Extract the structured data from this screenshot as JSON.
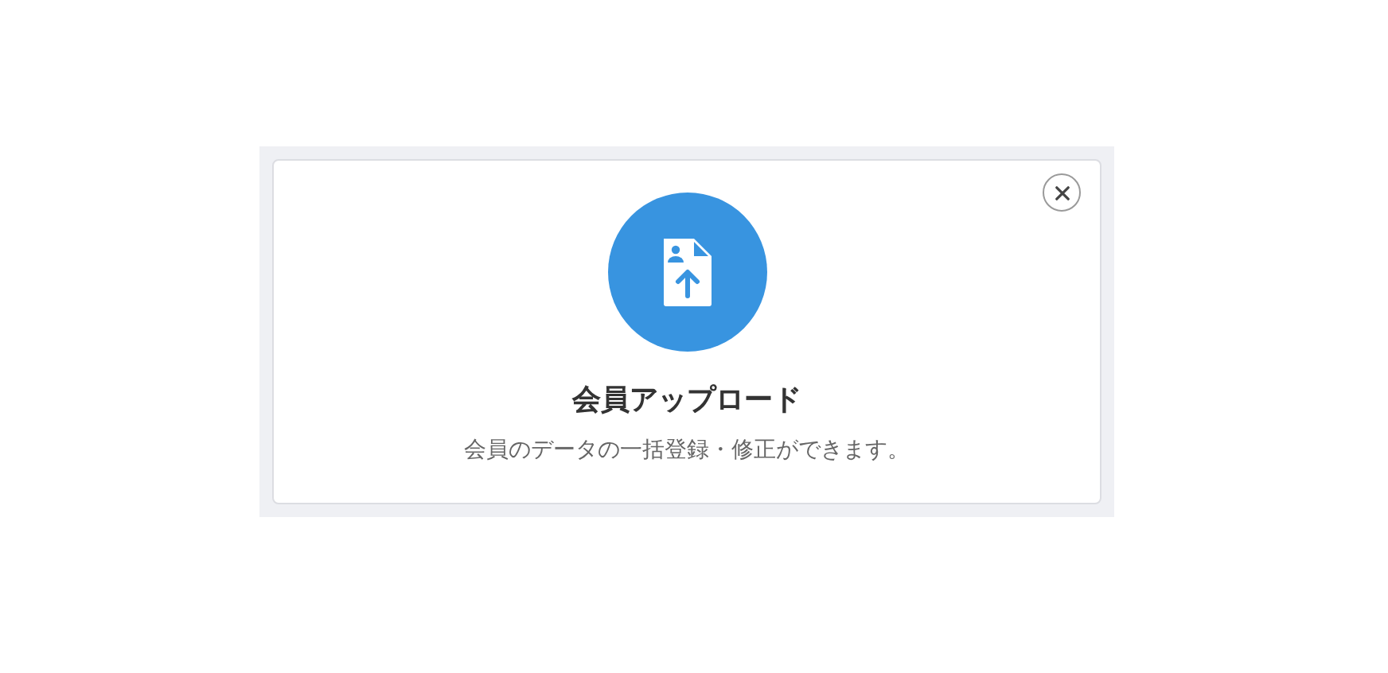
{
  "card": {
    "title": "会員アップロード",
    "description": "会員のデータの一括登録・修正ができます。"
  }
}
